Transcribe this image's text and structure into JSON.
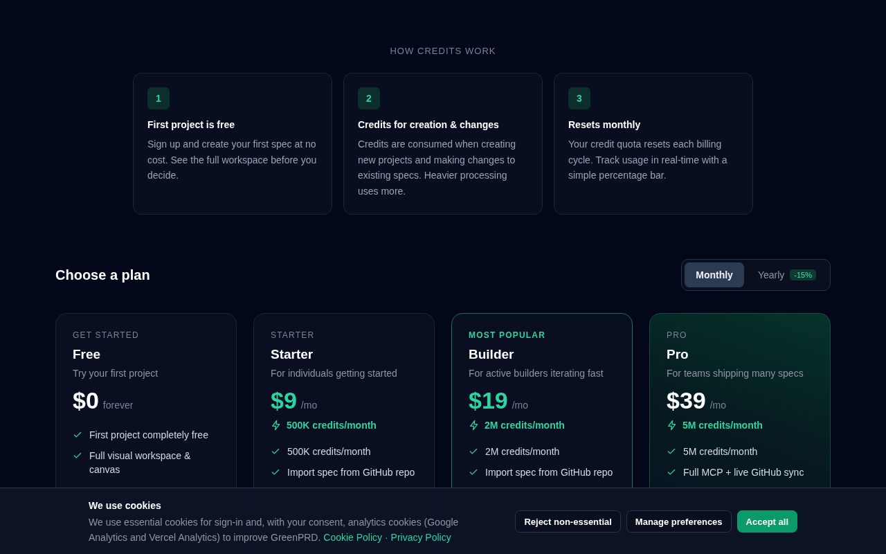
{
  "credits_section": {
    "heading": "HOW CREDITS WORK",
    "steps": [
      {
        "number": "1",
        "title": "First project is free",
        "text": "Sign up and create your first spec at no cost. See the full workspace before you decide."
      },
      {
        "number": "2",
        "title": "Credits for creation & changes",
        "text": "Credits are consumed when creating new projects and making changes to existing specs. Heavier processing uses more."
      },
      {
        "number": "3",
        "title": "Resets monthly",
        "text": "Your credit quota resets each billing cycle. Track usage in real-time with a simple percentage bar."
      }
    ]
  },
  "plans_section": {
    "heading": "Choose a plan",
    "billing_toggle": [
      {
        "label": "Monthly",
        "selected": true
      },
      {
        "label": "Yearly",
        "badge": "-15%",
        "selected": false
      }
    ],
    "plans": [
      {
        "kind": "default",
        "tag": "GET STARTED",
        "name": "Free",
        "description": "Try your first project",
        "price": "$0",
        "price_accent": false,
        "unit": "forever",
        "features": [
          "First project completely free",
          "Full visual workspace & canvas"
        ]
      },
      {
        "kind": "default",
        "tag": "STARTER",
        "name": "Starter",
        "description": "For individuals getting started",
        "price": "$9",
        "price_accent": true,
        "unit": "/mo",
        "credits": "500K credits/month",
        "features": [
          "500K credits/month",
          "Import spec from GitHub repo"
        ]
      },
      {
        "kind": "popular",
        "tag": "MOST POPULAR",
        "name": "Builder",
        "description": "For active builders iterating fast",
        "price": "$19",
        "price_accent": true,
        "unit": "/mo",
        "credits": "2M credits/month",
        "features": [
          "2M credits/month",
          "Import spec from GitHub repo"
        ]
      },
      {
        "kind": "glow",
        "tag": "PRO",
        "name": "Pro",
        "description": "For teams shipping many specs",
        "price": "$39",
        "price_accent": false,
        "unit": "/mo",
        "credits": "5M credits/month",
        "features": [
          "5M credits/month",
          "Full MCP + live GitHub sync"
        ]
      }
    ]
  },
  "cookie_banner": {
    "title": "We use cookies",
    "text": "We use essential cookies for sign-in and, with your consent, analytics cookies (Google Analytics and Vercel Analytics) to improve GreenPRD.",
    "links": [
      "Cookie Policy",
      "Privacy Policy"
    ],
    "separator": "·",
    "buttons": [
      {
        "label": "Reject non-essential",
        "kind": "outline"
      },
      {
        "label": "Manage preferences",
        "kind": "outline"
      },
      {
        "label": "Accept all",
        "kind": "primary"
      }
    ]
  }
}
